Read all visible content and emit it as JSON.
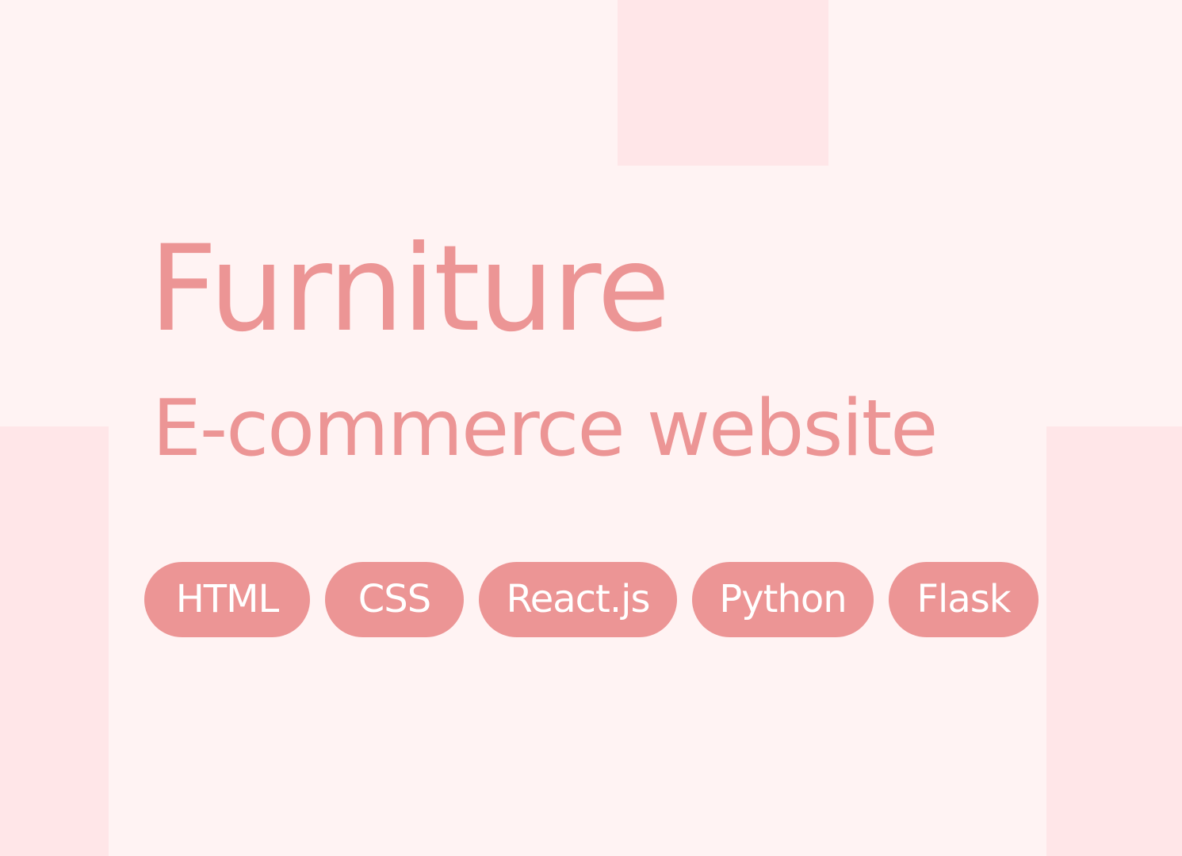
{
  "title": "Furniture",
  "subtitle": "E-commerce website",
  "tags": [
    "HTML",
    "CSS",
    "React.js",
    "Python",
    "Flask"
  ],
  "colors": {
    "background": "#fff3f3",
    "decor_block": "#ffe6e8",
    "accent": "#ec9595",
    "tag_text": "#ffffff"
  }
}
